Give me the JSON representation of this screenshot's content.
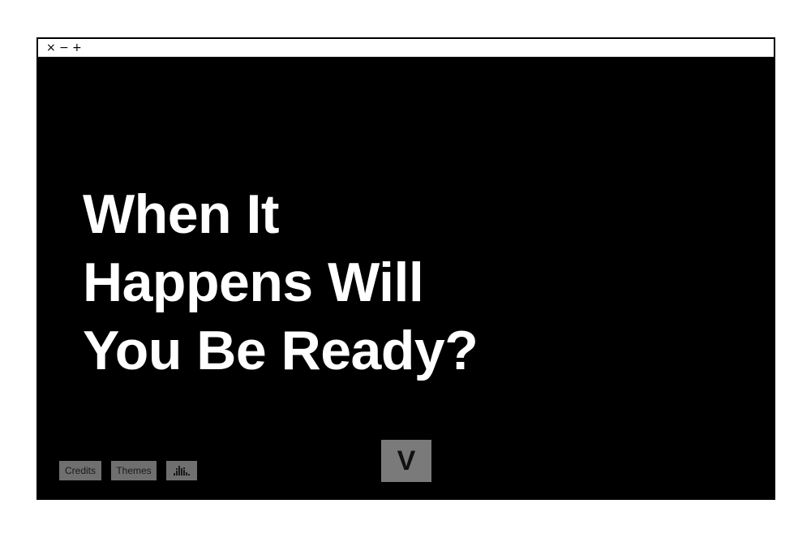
{
  "window": {
    "controls": {
      "close": "×",
      "minimize": "−",
      "maximize": "+"
    }
  },
  "headline": {
    "lines": [
      "When It",
      "Happens Will",
      "You Be Ready?"
    ]
  },
  "footer": {
    "credits_label": "Credits",
    "themes_label": "Themes",
    "stats_icon": "bar-chart-icon",
    "v_label": "V"
  },
  "colors": {
    "background": "#000000",
    "text": "#ffffff",
    "button": "#6f6f6f"
  }
}
